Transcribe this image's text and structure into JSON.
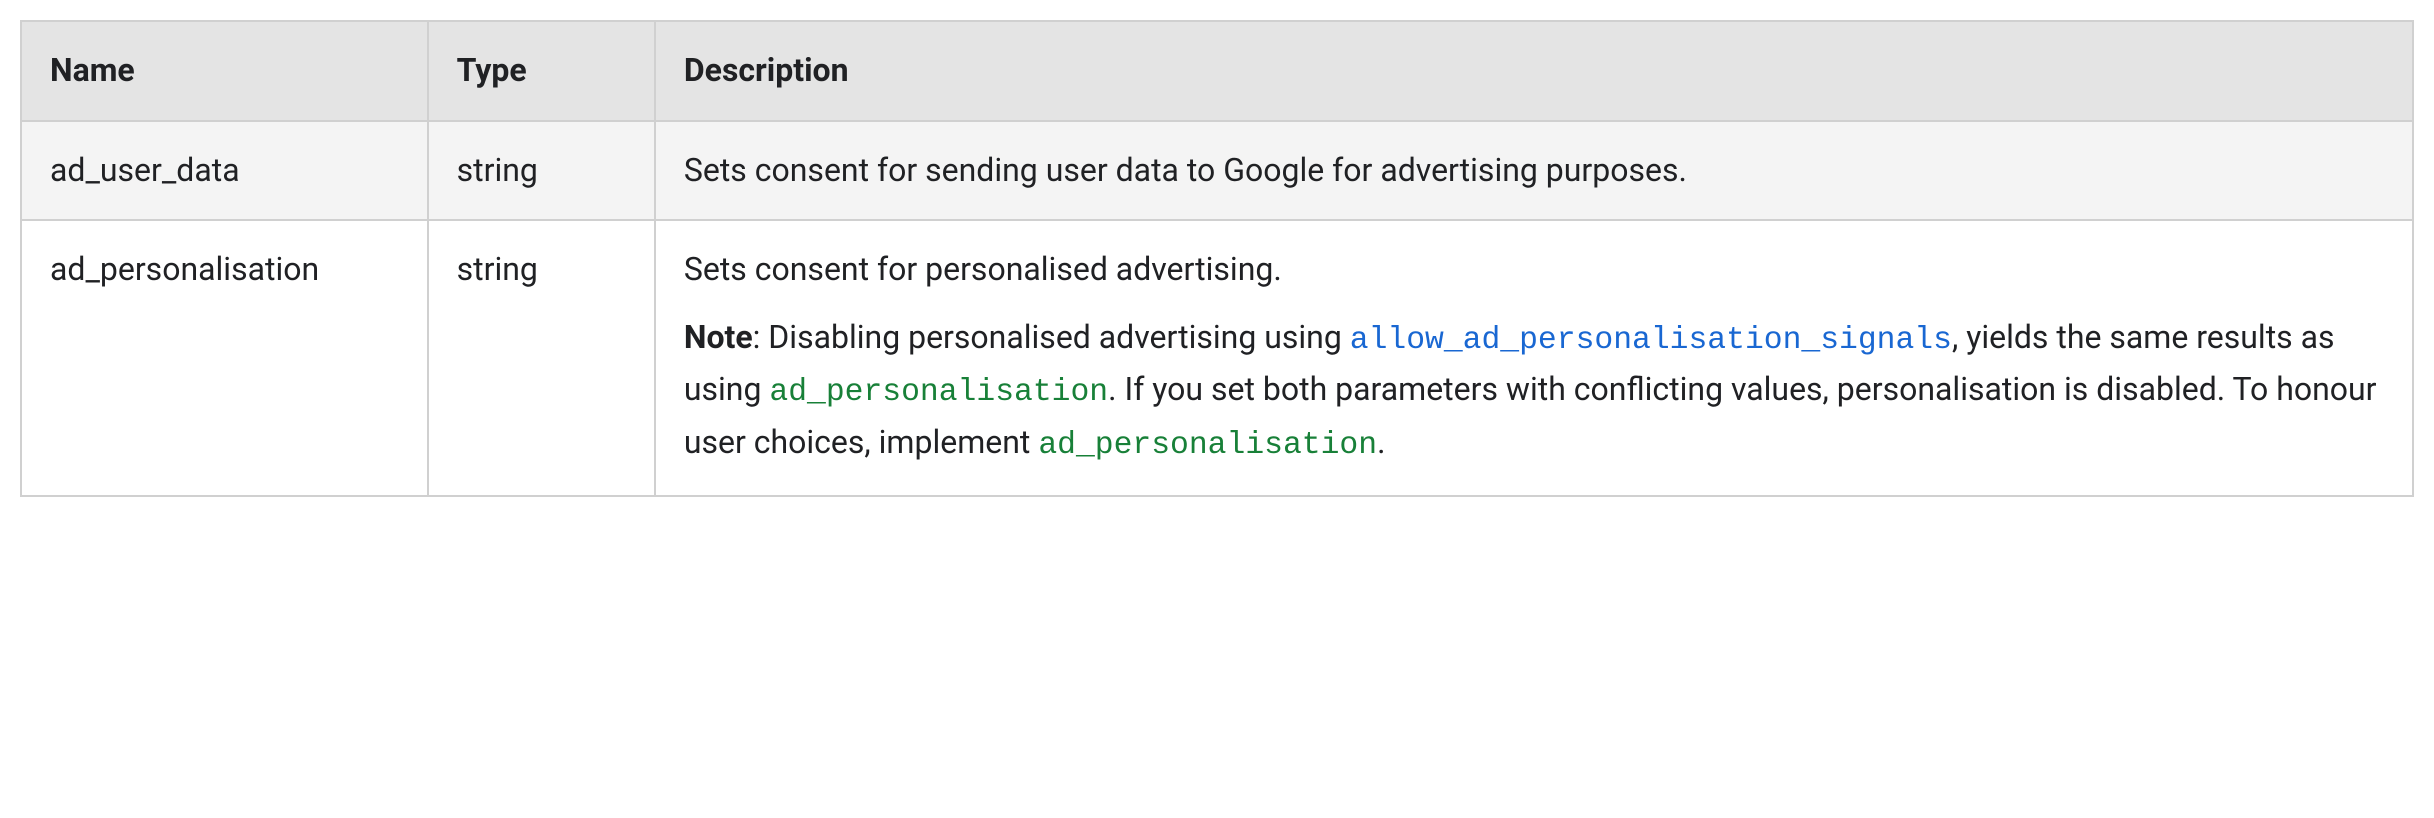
{
  "headers": {
    "name": "Name",
    "type": "Type",
    "description": "Description"
  },
  "rows": {
    "r0": {
      "name": "ad_user_data",
      "type": "string",
      "desc": "Sets consent for sending user data to Google for advertising purposes."
    },
    "r1": {
      "name": "ad_personalisation",
      "type": "string",
      "desc_p1": "Sets consent for personalised advertising.",
      "note_label": "Note",
      "note_text_1": ": Disabling personalised advertising using ",
      "code_link": "allow_ad_personalisation_signals",
      "note_text_2": ", yields the same results as using ",
      "code_green_1": "ad_personalisation",
      "note_text_3": ". If you set both parameters with conflicting values, personalisation is disabled. To honour user choices, implement ",
      "code_green_2": "ad_personalisation",
      "note_text_4": "."
    }
  }
}
